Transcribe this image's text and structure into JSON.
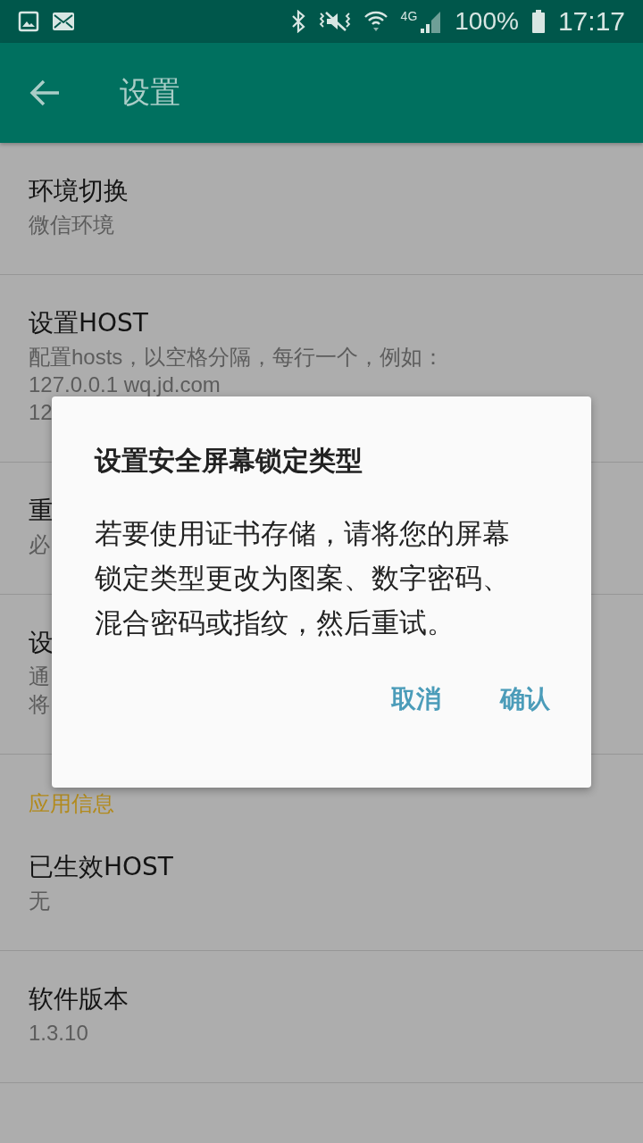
{
  "status_bar": {
    "network": "4G",
    "battery": "100%",
    "time": "17:17"
  },
  "app_bar": {
    "title": "设置"
  },
  "settings": [
    {
      "kind": "item",
      "title": "环境切换",
      "subtitle_lines": [
        "微信环境"
      ]
    },
    {
      "kind": "item",
      "title": "设置HOST",
      "subtitle_lines": [
        "配置hosts，以空格分隔，每行一个，例如：",
        "127.0.0.1 wq.jd.com",
        "12"
      ]
    },
    {
      "kind": "item",
      "title": "重",
      "subtitle_lines": [
        "必"
      ]
    },
    {
      "kind": "item",
      "title": "设",
      "subtitle_lines": [
        "通",
        "将"
      ]
    },
    {
      "kind": "section",
      "title": "应用信息"
    },
    {
      "kind": "item",
      "title": "已生效HOST",
      "subtitle_lines": [
        "无"
      ]
    },
    {
      "kind": "item",
      "title": "软件版本",
      "subtitle_lines": [
        "1.3.10"
      ]
    }
  ],
  "dialog": {
    "title": "设置安全屏幕锁定类型",
    "message": "若要使用证书存储，请将您的屏幕锁定类型更改为图案、数字密码、混合密码或指纹，然后重试。",
    "buttons": [
      "取消",
      "确认"
    ]
  }
}
